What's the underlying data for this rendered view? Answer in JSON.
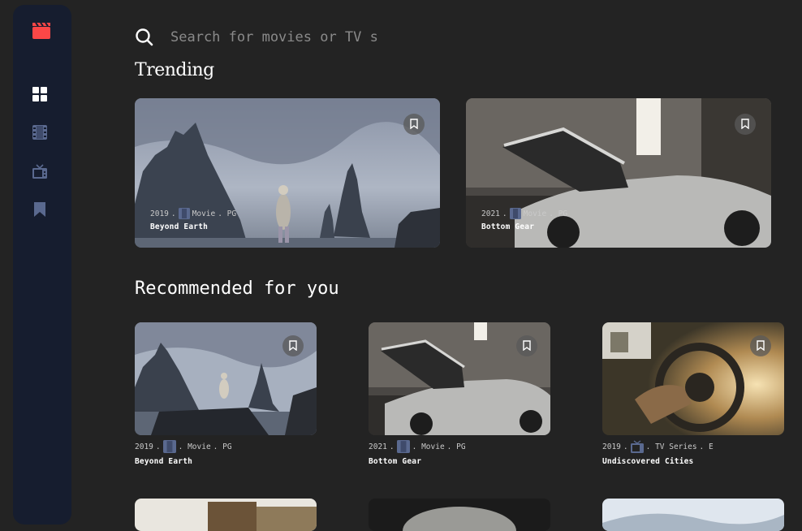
{
  "sidebar": {
    "logo": "film-clapper-icon",
    "brand_color": "#fc4747",
    "items": [
      {
        "icon": "grid-icon",
        "label": "Home",
        "active": true
      },
      {
        "icon": "film-strip-icon",
        "label": "Movies",
        "active": false
      },
      {
        "icon": "tv-icon",
        "label": "TV Series",
        "active": false
      },
      {
        "icon": "bookmark-icon",
        "label": "Bookmarks",
        "active": false
      }
    ]
  },
  "search": {
    "icon": "search-icon",
    "placeholder": "Search for movies or TV s",
    "value": ""
  },
  "trending": {
    "heading": "Trending",
    "items": [
      {
        "year": "2019",
        "sep": ".",
        "category": "Movie",
        "rating": ". PG",
        "title": "Beyond Earth",
        "bookmark_icon": "bookmark-icon"
      },
      {
        "year": "2021",
        "sep": ".",
        "category": "Movie",
        "rating": ". PG",
        "title": "Bottom Gear",
        "bookmark_icon": "bookmark-icon"
      }
    ]
  },
  "recommended": {
    "heading": "Recommended for you",
    "items": [
      {
        "year": "2019",
        "sep": ".",
        "category": ". Movie",
        "rating": ". PG",
        "title": "Beyond Earth"
      },
      {
        "year": "2021",
        "sep": ".",
        "category": ". Movie",
        "rating": ". PG",
        "title": "Bottom Gear"
      },
      {
        "year": "2019",
        "sep": ".",
        "category": ". TV Series",
        "rating": ". E",
        "title": "Undiscovered Cities"
      }
    ]
  },
  "colors": {
    "background": "#232323",
    "sidebar": "#161d2f",
    "icon_inactive": "#5a698f",
    "accent": "#fc4747"
  }
}
